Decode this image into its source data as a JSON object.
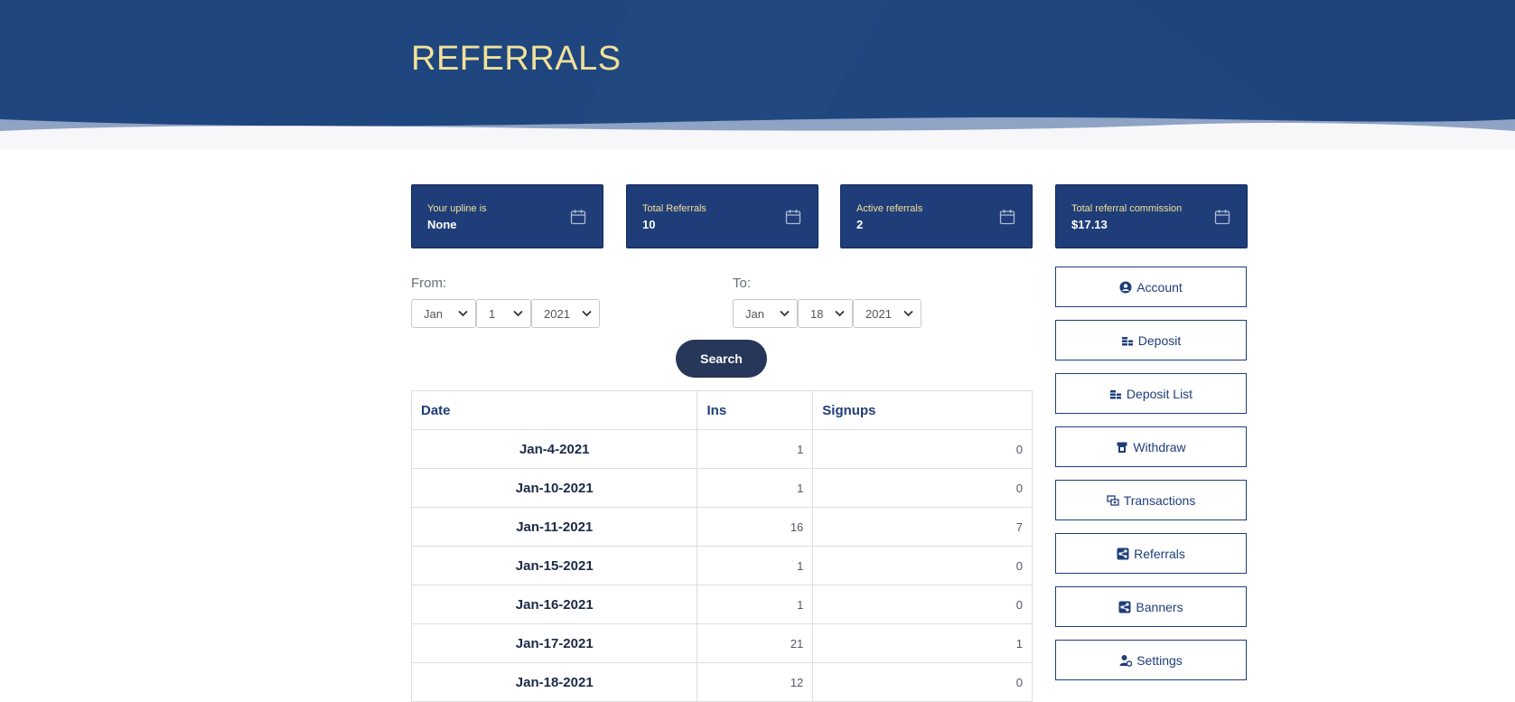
{
  "page": {
    "title": "REFERRALS"
  },
  "stats": [
    {
      "label": "Your upline is",
      "value": "None",
      "icon": "calendar-icon"
    },
    {
      "label": "Total Referrals",
      "value": "10",
      "icon": "calendar-icon"
    },
    {
      "label": "Active referrals",
      "value": "2",
      "icon": "calendar-icon"
    },
    {
      "label": "Total referral commission",
      "value": "$17.13",
      "icon": "calendar-icon"
    }
  ],
  "filter": {
    "from_label": "From:",
    "to_label": "To:",
    "from": {
      "month": "Jan",
      "day": "1",
      "year": "2021"
    },
    "to": {
      "month": "Jan",
      "day": "18",
      "year": "2021"
    },
    "search_label": "Search"
  },
  "table": {
    "headers": [
      "Date",
      "Ins",
      "Signups"
    ],
    "rows": [
      {
        "date": "Jan-4-2021",
        "ins": "1",
        "signups": "0"
      },
      {
        "date": "Jan-10-2021",
        "ins": "1",
        "signups": "0"
      },
      {
        "date": "Jan-11-2021",
        "ins": "16",
        "signups": "7"
      },
      {
        "date": "Jan-15-2021",
        "ins": "1",
        "signups": "0"
      },
      {
        "date": "Jan-16-2021",
        "ins": "1",
        "signups": "0"
      },
      {
        "date": "Jan-17-2021",
        "ins": "21",
        "signups": "1"
      },
      {
        "date": "Jan-18-2021",
        "ins": "12",
        "signups": "0"
      }
    ]
  },
  "nav": [
    {
      "label": "Account",
      "icon": "user-icon"
    },
    {
      "label": "Deposit",
      "icon": "coins-icon"
    },
    {
      "label": "Deposit List",
      "icon": "coins-icon"
    },
    {
      "label": "Withdraw",
      "icon": "atm-icon"
    },
    {
      "label": "Transactions",
      "icon": "exchange-icon"
    },
    {
      "label": "Referrals",
      "icon": "share-icon"
    },
    {
      "label": "Banners",
      "icon": "share-icon"
    },
    {
      "label": "Settings",
      "icon": "user-gear-icon"
    }
  ],
  "colors": {
    "primary": "#1f3d78",
    "accent": "#f2e199",
    "button": "#263759"
  }
}
